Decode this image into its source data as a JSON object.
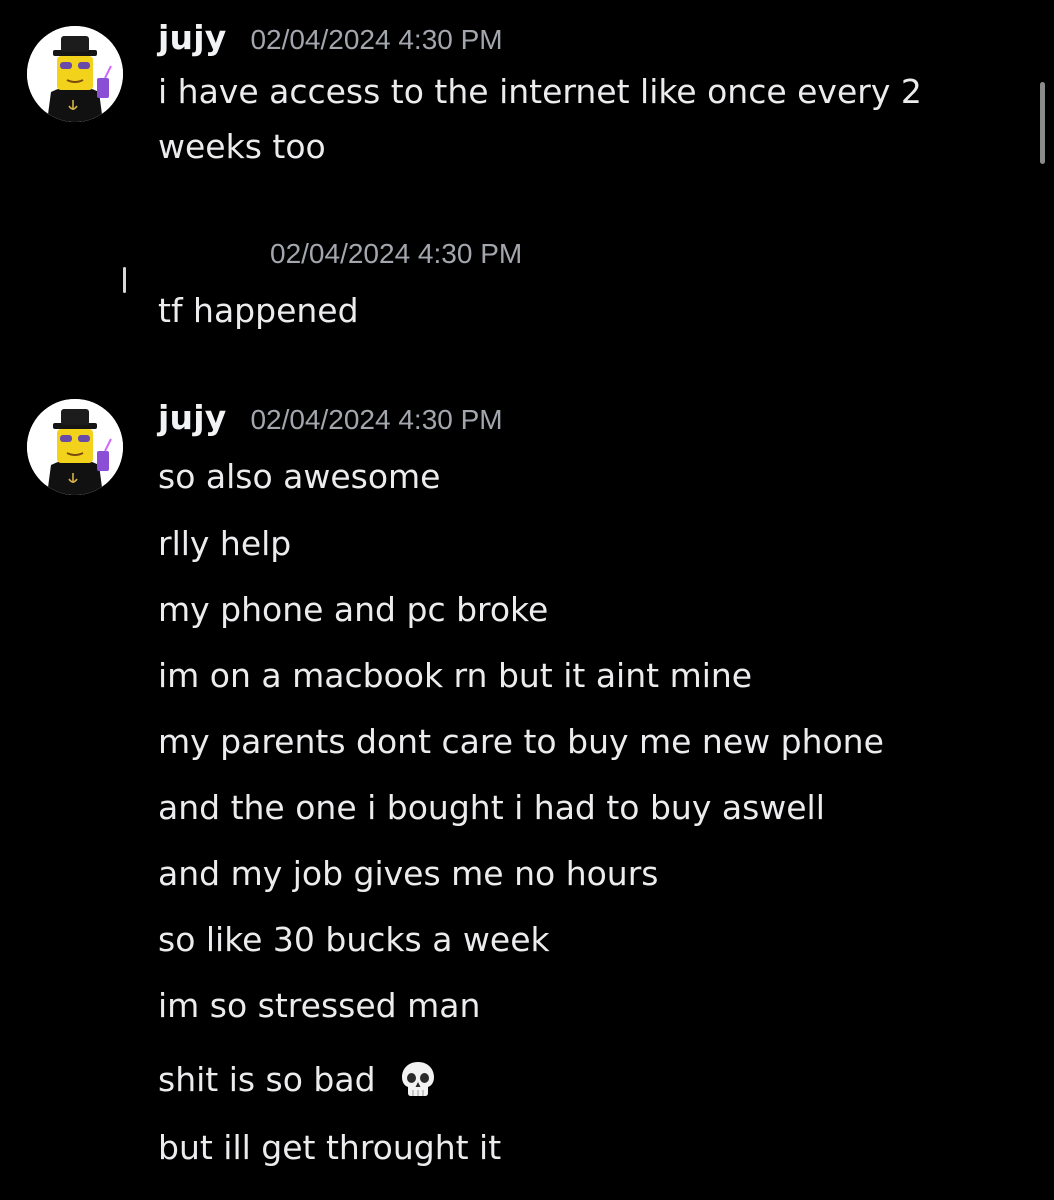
{
  "messages": [
    {
      "username": "jujy",
      "timestamp": "02/04/2024 4:30 PM",
      "lines": [
        "i have access to the internet like once every 2 weeks too"
      ]
    },
    {
      "username": "",
      "timestamp": "02/04/2024 4:30 PM",
      "lines": [
        "tf happened"
      ]
    },
    {
      "username": "jujy",
      "timestamp": "02/04/2024 4:30 PM",
      "lines": [
        "so also awesome",
        "rlly help",
        "my phone and pc broke",
        "im on a macbook rn but it aint mine",
        "my parents dont care to buy me new phone",
        "and the one i bought i had to buy aswell",
        "and my job gives me no hours",
        "so like 30 bucks a week",
        "im so stressed man",
        "shit is so bad",
        "but ill get throught it"
      ],
      "emoji_after_line_10": "skull-emoji"
    }
  ],
  "colors": {
    "background": "#000000",
    "username": "#f2f3f5",
    "timestamp": "#a3a6ad",
    "message_text": "#ececee",
    "scrollbar": "#8b8b8b"
  }
}
